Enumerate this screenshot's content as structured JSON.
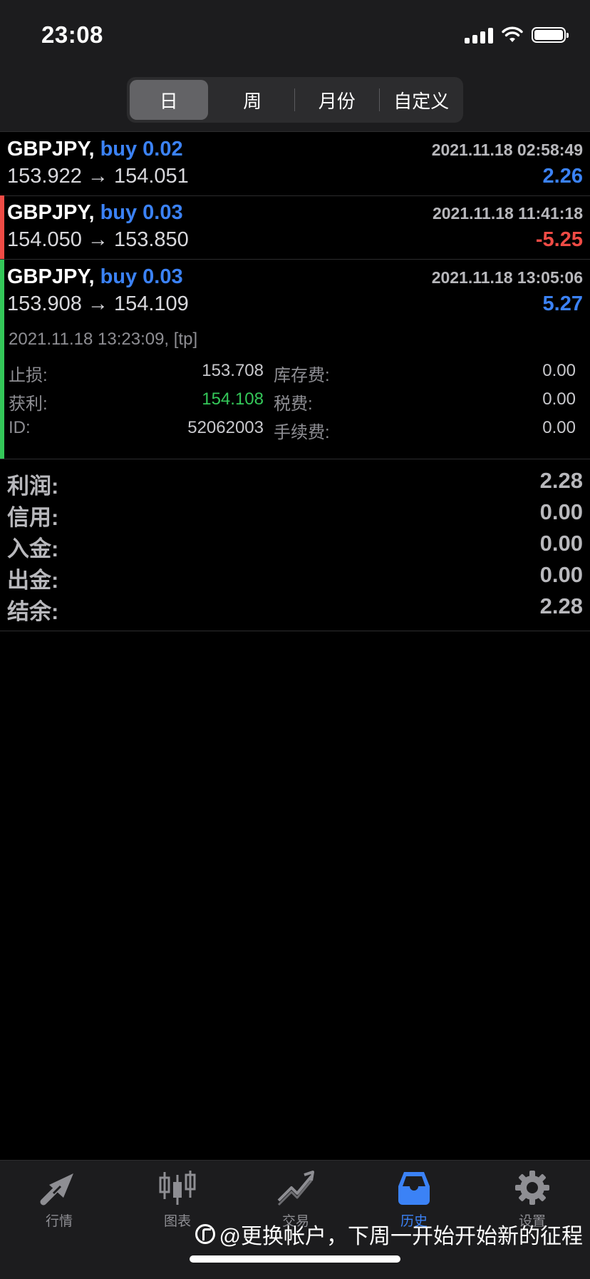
{
  "status_bar": {
    "time": "23:08",
    "icons": [
      "signal-icon",
      "wifi-icon",
      "battery-icon"
    ]
  },
  "segments": [
    {
      "label": "日",
      "active": true
    },
    {
      "label": "周",
      "active": false
    },
    {
      "label": "月份",
      "active": false
    },
    {
      "label": "自定义",
      "active": false
    }
  ],
  "deals": [
    {
      "symbol": "GBPJPY,",
      "side": "buy 0.02",
      "time": "2021.11.18 02:58:49",
      "prices": "153.922 → 154.051",
      "profit": "2.26",
      "accent": "none"
    },
    {
      "symbol": "GBPJPY,",
      "side": "buy 0.03",
      "time": "2021.11.18 11:41:18",
      "prices": "154.050 → 153.850",
      "profit": "-5.25",
      "accent": "#ef4b45"
    },
    {
      "symbol": "GBPJPY,",
      "side": "buy 0.03",
      "time": "2021.11.18 13:05:06",
      "prices": "153.908 → 154.109",
      "profit": "5.27",
      "accent": "#34c759",
      "details": {
        "close": "2021.11.18 13:23:09, [tp]",
        "rows": [
          {
            "l1": "止损:",
            "v1": "153.708",
            "l2": "库存费:",
            "v2": "0.00"
          },
          {
            "l1": "获利:",
            "v1": "154.108",
            "l2": "税费:",
            "v2": "0.00"
          },
          {
            "l1": "ID:",
            "v1": "52062003",
            "l2": "手续费:",
            "v2": "0.00"
          }
        ]
      }
    }
  ],
  "summary": [
    {
      "label": "利润:",
      "value": "2.28"
    },
    {
      "label": "信用:",
      "value": "0.00"
    },
    {
      "label": "入金:",
      "value": "0.00"
    },
    {
      "label": "出金:",
      "value": "0.00"
    },
    {
      "label": "结余:",
      "value": "2.28"
    }
  ],
  "tabs": [
    {
      "label": "行情",
      "icon": "quotes-icon",
      "active": false
    },
    {
      "label": "图表",
      "icon": "chart-icon",
      "active": false
    },
    {
      "label": "交易",
      "icon": "trade-icon",
      "active": false
    },
    {
      "label": "历史",
      "icon": "history-icon",
      "active": true
    },
    {
      "label": "设置",
      "icon": "settings-icon",
      "active": false
    }
  ],
  "watermark": "@更换帐户，下周一开始开始新的征程",
  "colors": {
    "accent_blue": "#3b82f6",
    "loss_red": "#ef4b45",
    "take_profit_green": "#34c759"
  }
}
